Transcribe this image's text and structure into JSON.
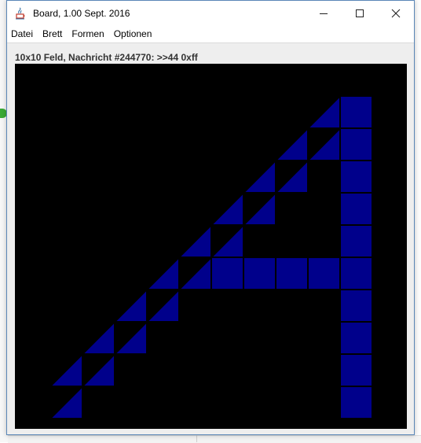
{
  "window": {
    "title": "Board, 1.00 Sept. 2016",
    "controls": {
      "minimize_icon": "minimize-icon",
      "maximize_icon": "maximize-icon",
      "close_icon": "close-icon"
    }
  },
  "menu": {
    "items": [
      {
        "label": "Datei"
      },
      {
        "label": "Brett"
      },
      {
        "label": "Formen"
      },
      {
        "label": "Optionen"
      }
    ]
  },
  "status": {
    "text": "10x10 Feld, Nachricht #244770: >>44 0xff"
  },
  "board": {
    "grid_size": "10x10",
    "cell_color": "#00008b",
    "background_color": "#000000",
    "grid_line_color": "#000000",
    "squares": [
      [
        9,
        0
      ],
      [
        9,
        1
      ],
      [
        9,
        2
      ],
      [
        9,
        3
      ],
      [
        9,
        4
      ],
      [
        9,
        5
      ],
      [
        9,
        6
      ],
      [
        9,
        7
      ],
      [
        9,
        8
      ],
      [
        9,
        9
      ],
      [
        5,
        5
      ],
      [
        6,
        5
      ],
      [
        7,
        5
      ],
      [
        8,
        5
      ]
    ],
    "triangles": [
      [
        8,
        0
      ],
      [
        8,
        1
      ],
      [
        7,
        1
      ],
      [
        7,
        2
      ],
      [
        6,
        2
      ],
      [
        6,
        3
      ],
      [
        5,
        3
      ],
      [
        5,
        4
      ],
      [
        4,
        4
      ],
      [
        4,
        5
      ],
      [
        3,
        5
      ],
      [
        3,
        6
      ],
      [
        2,
        6
      ],
      [
        2,
        7
      ],
      [
        1,
        7
      ],
      [
        1,
        8
      ],
      [
        0,
        8
      ],
      [
        0,
        9
      ]
    ]
  }
}
